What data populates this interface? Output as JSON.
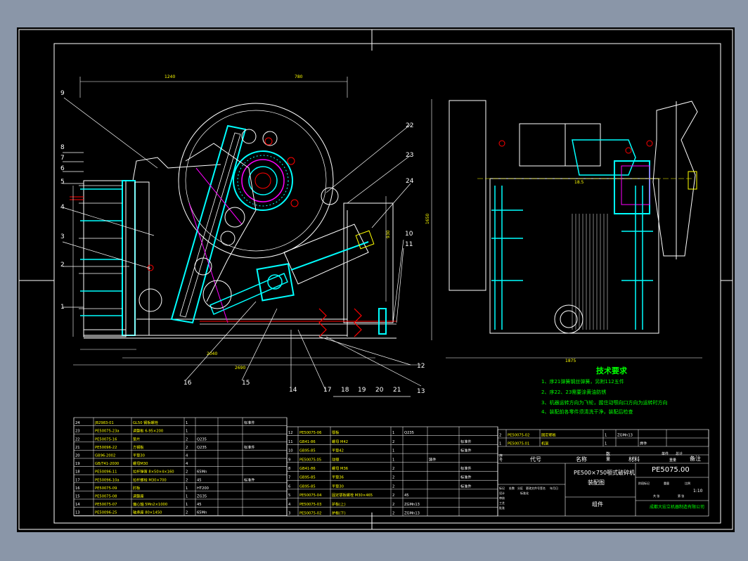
{
  "drawing": {
    "front_view_balloons": [
      "9",
      "8",
      "7",
      "6",
      "5",
      "4",
      "3",
      "2",
      "1",
      "22",
      "23",
      "24",
      "10",
      "11",
      "12",
      "13",
      "14",
      "15",
      "16",
      "17",
      "18",
      "19",
      "20",
      "21"
    ],
    "dimensions": {
      "width_top": "1240",
      "width_top2": "780",
      "height_right": "1650",
      "height_mid": "930",
      "base_width_1": "2040",
      "base_width_2": "2690",
      "side_width": "1875",
      "side_dim": "18.5"
    }
  },
  "tech_requirements": {
    "title": "技术要求",
    "items": [
      "1、序21弹簧钢丝弹簧，另附112五件",
      "2、序22、23需要涂黄油防锈",
      "3、机器运转方向为飞轮，握住动颚向口方向为运转时方向",
      "4、装配前各零件须清洗干净，装配后检查"
    ]
  },
  "bom_left": {
    "rows": [
      [
        "24",
        "JB2983-01",
        "GL50 钢板螺栓",
        "1",
        "",
        "",
        "标准件"
      ],
      [
        "23",
        "PE50075-23a",
        "调整板 6-95×200",
        "1",
        "",
        "",
        ""
      ],
      [
        "22",
        "PE50075-16",
        "垫片",
        "2",
        "Q235",
        "",
        ""
      ],
      [
        "21",
        "PE50096-22",
        "方钢板",
        "2",
        "Q235",
        "",
        "标准件"
      ],
      [
        "20",
        "GB96-2002",
        "平垫30",
        "4",
        "",
        "",
        ""
      ],
      [
        "19",
        "GB/T41-2000",
        "螺母M30",
        "4",
        "",
        "",
        ""
      ],
      [
        "18",
        "PE50096-11",
        "拉杆弹簧 8×50×4×160",
        "2",
        "65Mn",
        "",
        ""
      ],
      [
        "17",
        "PE50096-10a",
        "拉杆螺栓 M30×700",
        "2",
        "45",
        "",
        "标准件"
      ],
      [
        "16",
        "PE50075-09",
        "肘板",
        "1",
        "HT200",
        "",
        ""
      ],
      [
        "15",
        "PE50075-08",
        "调整座",
        "1",
        "ZG35",
        "",
        ""
      ],
      [
        "14",
        "PE50075-07",
        "偏心轴 5Mn2×1000",
        "1",
        "45",
        "",
        ""
      ],
      [
        "13",
        "PE50096-25",
        "轴承座 80×1450",
        "2",
        "65Mn",
        "",
        ""
      ]
    ]
  },
  "bom_mid": {
    "rows": [
      [
        "12",
        "PE50075-06",
        "鄂板",
        "1",
        "Q235",
        "",
        ""
      ],
      [
        "11",
        "GB41-86",
        "螺母 M42",
        "2",
        "",
        "",
        "标准件"
      ],
      [
        "10",
        "GB95-85",
        "平垫42",
        "1",
        "",
        "",
        "标准件"
      ],
      [
        "9",
        "PE50075.05",
        "动颚",
        "1",
        "",
        "铸件",
        ""
      ],
      [
        "8",
        "GB41-86",
        "螺母 M36",
        "2",
        "",
        "",
        "标准件"
      ],
      [
        "7",
        "GB95-85",
        "平垫36",
        "2",
        "",
        "",
        "标准件"
      ],
      [
        "6",
        "GB95-85",
        "平垫30",
        "2",
        "",
        "",
        "标准件"
      ],
      [
        "5",
        "PE50075-04",
        "固定鄂板螺栓 M30×465",
        "2",
        "45",
        "",
        ""
      ],
      [
        "4",
        "PE50075-03",
        "护板(上)",
        "2",
        "ZGMn13",
        "",
        ""
      ],
      [
        "3",
        "PE50075-02",
        "护板(下)",
        "2",
        "ZGMn13",
        "",
        ""
      ]
    ]
  },
  "bom_right": {
    "rows": [
      [
        "2",
        "PE50075-02",
        "固定鄂板",
        "1",
        "ZGMn13",
        "",
        ""
      ],
      [
        "1",
        "PE50075.01",
        "机架",
        "1",
        "",
        "焊件",
        ""
      ]
    ],
    "header": {
      "seq": "序号",
      "code": "代号",
      "name": "名称",
      "qty": "数量",
      "material": "材料",
      "unit_weight": "单件",
      "total_weight": "总计",
      "weight": "重量",
      "remark": "备注"
    }
  },
  "title_block": {
    "product": "PE500×750颚式破碎机",
    "sheet_name": "装配图",
    "drawing_no": "PE5075.00",
    "type": "组件",
    "scale": "1:10",
    "company": "成都大宏立机器制造有限公司",
    "labels": [
      "标记",
      "处数",
      "分区",
      "更改文件号",
      "签名",
      "年月日",
      "设计",
      "标准化",
      "阶段标记",
      "重量",
      "比例",
      "审核",
      "工艺",
      "批准",
      "共 张",
      "第 张"
    ]
  },
  "colors": {
    "bg": "#000000",
    "frame": "#ffffff",
    "part": "#00ffff",
    "green": "#00ff00",
    "yellow": "#ffff00",
    "red": "#ff0000",
    "magenta": "#ff00ff"
  }
}
